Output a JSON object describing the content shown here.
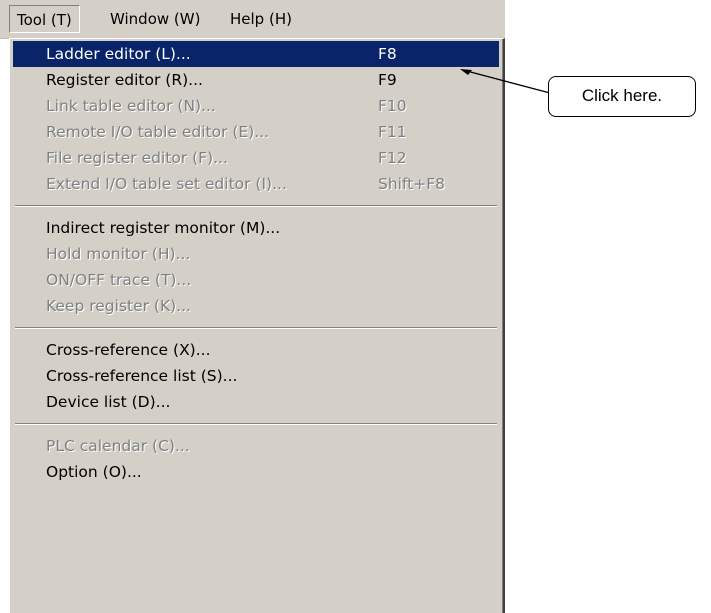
{
  "menubar": {
    "items": [
      {
        "label": "Tool (T)"
      },
      {
        "label": "Window (W)"
      },
      {
        "label": "Help (H)"
      }
    ]
  },
  "dropdown": {
    "items": [
      {
        "label": "Ladder editor (L)...",
        "shortcut": "F8",
        "enabled": true,
        "selected": true
      },
      {
        "label": "Register editor (R)...",
        "shortcut": "F9",
        "enabled": true
      },
      {
        "label": "Link table editor (N)...",
        "shortcut": "F10",
        "enabled": false
      },
      {
        "label": "Remote I/O table editor (E)...",
        "shortcut": "F11",
        "enabled": false
      },
      {
        "label": "File register editor (F)...",
        "shortcut": "F12",
        "enabled": false
      },
      {
        "label": "Extend I/O table set editor (I)...",
        "shortcut": "Shift+F8",
        "enabled": false
      },
      {
        "label": "Indirect register monitor (M)...",
        "enabled": true
      },
      {
        "label": "Hold monitor (H)...",
        "enabled": false
      },
      {
        "label": "ON/OFF trace (T)...",
        "enabled": false
      },
      {
        "label": "Keep register (K)...",
        "enabled": false
      },
      {
        "label": "Cross-reference (X)...",
        "enabled": true
      },
      {
        "label": "Cross-reference list (S)...",
        "enabled": true
      },
      {
        "label": "Device list (D)...",
        "enabled": true
      },
      {
        "label": "PLC calendar (C)...",
        "enabled": false
      },
      {
        "label": "Option (O)...",
        "enabled": true
      }
    ]
  },
  "callout": {
    "text": "Click here."
  },
  "colors": {
    "menu_bg": "#d4d0c8",
    "highlight": "#0a246a",
    "disabled_text": "#808080"
  }
}
